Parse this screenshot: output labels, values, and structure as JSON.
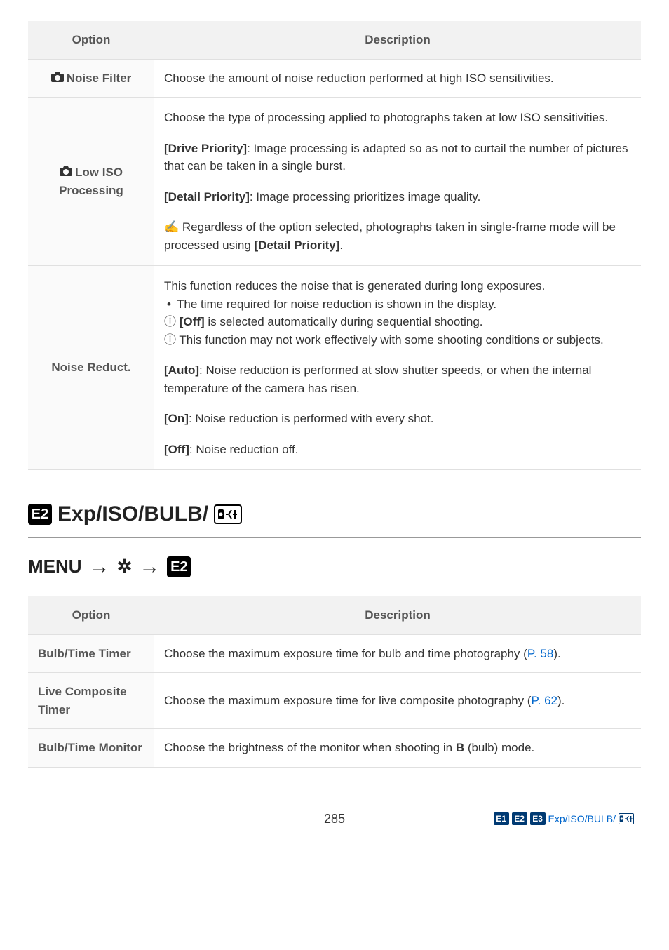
{
  "table1": {
    "headers": {
      "option": "Option",
      "description": "Description"
    },
    "rows": [
      {
        "option_icon": "📷",
        "option_label": "Noise Filter",
        "desc": "Choose the amount of noise reduction performed at high ISO sensitivities."
      },
      {
        "option_icon": "📷",
        "option_label": "Low ISO Processing",
        "blocks": {
          "intro": "Choose the type of processing applied to photographs taken at low ISO sensitivities.",
          "drive_label": "[Drive Priority]",
          "drive_text": ": Image processing is adapted so as not to curtail the number of pictures that can be taken in a single burst.",
          "detail_label": "[Detail Priority]",
          "detail_text": ": Image processing prioritizes image quality.",
          "hint_text": "Regardless of the option selected, photographs taken in single-frame mode will be processed using ",
          "hint_bold": "[Detail Priority]",
          "hint_suffix": "."
        }
      },
      {
        "option_label": "Noise Reduct.",
        "blocks": {
          "intro": "This function reduces the noise that is generated during long exposures.",
          "bullet1": "The time required for noise reduction is shown in the display.",
          "info1_bold": "[Off]",
          "info1_text": " is selected automatically during sequential shooting.",
          "info2_text": "This function may not work effectively with some shooting conditions or subjects.",
          "auto_label": "[Auto]",
          "auto_text": ": Noise reduction is performed at slow shutter speeds, or when the internal temperature of the camera has risen.",
          "on_label": "[On]",
          "on_text": ": Noise reduction is performed with every shot.",
          "off_label": "[Off]",
          "off_text": ": Noise reduction off."
        }
      }
    ]
  },
  "section2": {
    "heading_text": "Exp/ISO/BULB/",
    "menu_label": "MENU"
  },
  "table2": {
    "headers": {
      "option": "Option",
      "description": "Description"
    },
    "rows": [
      {
        "option": "Bulb/Time Timer",
        "desc_pre": "Choose the maximum exposure time for bulb and time photography (",
        "link": "P. 58",
        "desc_post": ")."
      },
      {
        "option": "Live Composite Timer",
        "desc_pre": "Choose the maximum exposure time for live composite photography (",
        "link": "P. 62",
        "desc_post": ")."
      },
      {
        "option": "Bulb/Time Monitor",
        "desc_pre": "Choose the brightness of the monitor when shooting in ",
        "bold": "B",
        "desc_post": " (bulb) mode."
      }
    ]
  },
  "footer": {
    "page": "285",
    "badges": [
      "E1",
      "E2",
      "E3"
    ],
    "label": " Exp/ISO/BULB/"
  }
}
